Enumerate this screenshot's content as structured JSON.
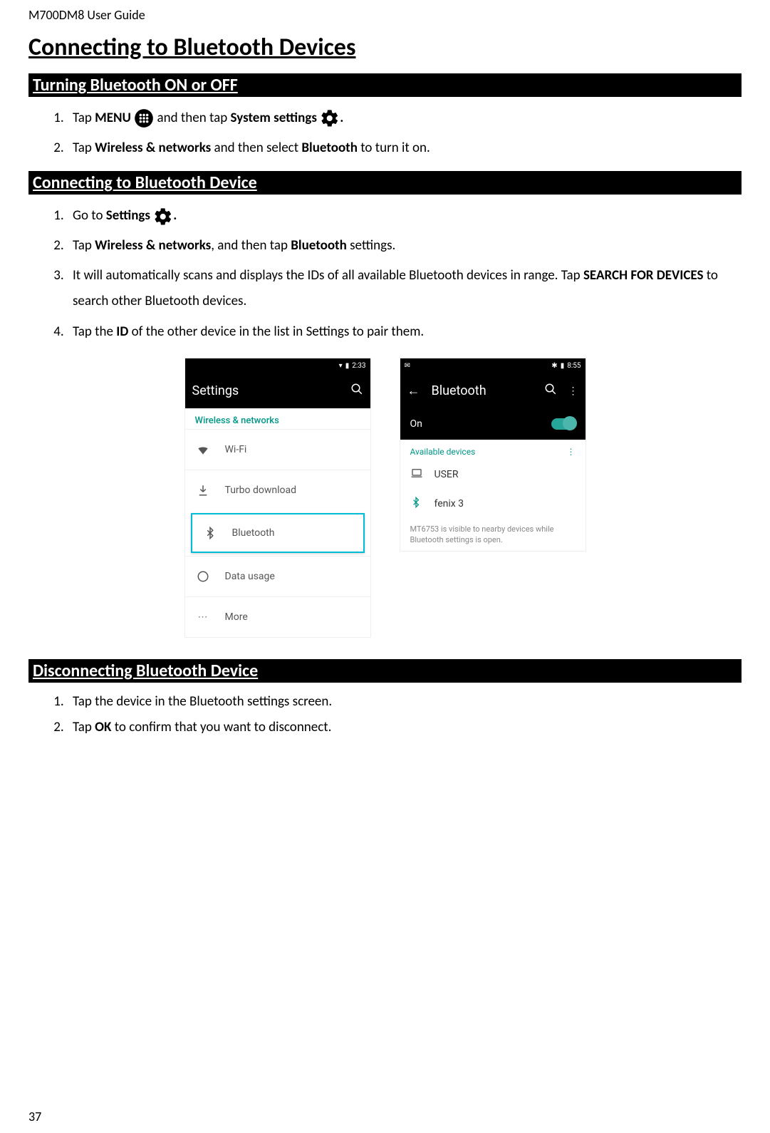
{
  "doc": {
    "header": "M700DM8 User Guide",
    "page_number": "37"
  },
  "title": "Connecting to Bluetooth Devices",
  "section1": {
    "heading": "Turning Bluetooth ON or OFF",
    "step1_a": "Tap ",
    "step1_b": "MENU",
    "step1_c": " and then tap ",
    "step1_d": "System settings",
    "step1_e": ".",
    "step2_a": "Tap ",
    "step2_b": "Wireless & networks",
    "step2_c": " and then select ",
    "step2_d": "Bluetooth",
    "step2_e": " to turn it on."
  },
  "section2": {
    "heading": "Connecting to Bluetooth Device",
    "step1_a": "Go to ",
    "step1_b": "Settings",
    "step1_c": ".",
    "step2_a": "Tap ",
    "step2_b": "Wireless & networks",
    "step2_c": ", and then tap ",
    "step2_d": "Bluetooth",
    "step2_e": " settings.",
    "step3_a": "It will automatically scans and displays the IDs of all available Bluetooth devices in range. Tap ",
    "step3_b": "SEARCH FOR DEVICES",
    "step3_c": " to search other Bluetooth devices.",
    "step4_a": "Tap the ",
    "step4_b": "ID",
    "step4_c": " of the other device in the list in Settings to pair them."
  },
  "section3": {
    "heading": "Disconnecting Bluetooth Device",
    "step1": "Tap the device in the Bluetooth settings screen.",
    "step2_a": "Tap ",
    "step2_b": "OK",
    "step2_c": " to confirm that you want to disconnect."
  },
  "shot_settings": {
    "time": "2:33",
    "title": "Settings",
    "subheader": "Wireless & networks",
    "rows": {
      "wifi": "Wi-Fi",
      "turbo": "Turbo download",
      "bluetooth": "Bluetooth",
      "data": "Data usage",
      "more": "More"
    }
  },
  "shot_bluetooth": {
    "time": "8:55",
    "title": "Bluetooth",
    "on_label": "On",
    "available": "Available devices",
    "device1": "USER",
    "device2": "fenix 3",
    "note": "MT6753 is visible to nearby devices while Bluetooth settings is open."
  }
}
